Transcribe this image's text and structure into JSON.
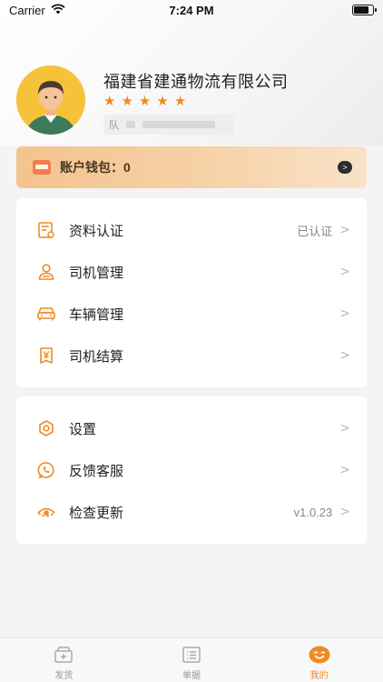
{
  "status_bar": {
    "carrier": "Carrier",
    "time": "7:24 PM"
  },
  "profile": {
    "company_name": "福建省建通物流有限公司",
    "stars": [
      "★",
      "★",
      "★",
      "★",
      "★"
    ],
    "phone_prefix": "队"
  },
  "wallet": {
    "label": "账户钱包：0",
    "arrow": ">"
  },
  "menu_main": [
    {
      "label": "资料认证",
      "value": "已认证",
      "icon": "id-card-icon"
    },
    {
      "label": "司机管理",
      "value": "",
      "icon": "driver-icon"
    },
    {
      "label": "车辆管理",
      "value": "",
      "icon": "car-icon"
    },
    {
      "label": "司机结算",
      "value": "",
      "icon": "yuan-icon"
    }
  ],
  "menu_other": [
    {
      "label": "设置",
      "value": "",
      "icon": "settings-icon"
    },
    {
      "label": "反馈客服",
      "value": "",
      "icon": "phone-icon"
    },
    {
      "label": "检查更新",
      "value": "v1.0.23",
      "icon": "update-eye-icon"
    }
  ],
  "chevron": ">",
  "tabs": [
    {
      "label": "发货",
      "icon": "box-icon"
    },
    {
      "label": "单据",
      "icon": "document-list-icon"
    },
    {
      "label": "我的",
      "icon": "smile-face-icon"
    }
  ],
  "colors": {
    "accent": "#f08a24",
    "wallet_start": "#f3c38e",
    "wallet_end": "#f9e2c8"
  }
}
